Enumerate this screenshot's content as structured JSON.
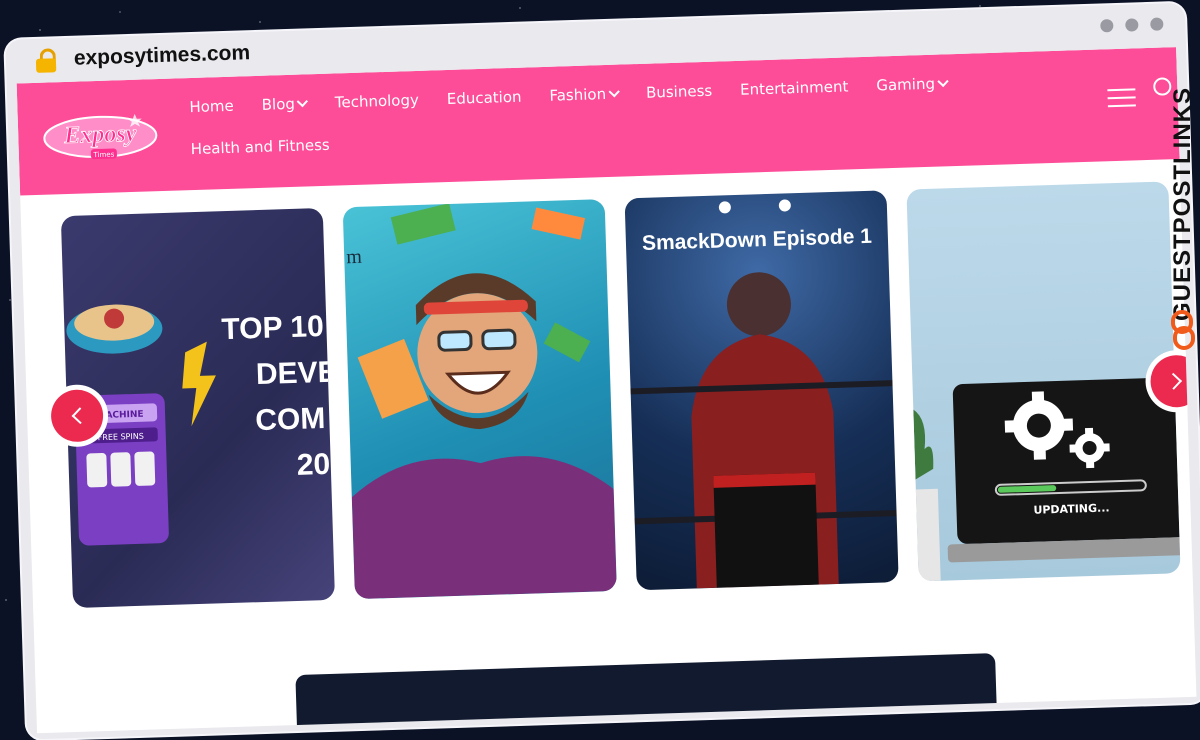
{
  "browser": {
    "url": "exposytimes.com"
  },
  "header": {
    "logo_text": "Exposy",
    "logo_subtext": "Times",
    "nav": [
      {
        "label": "Home",
        "dropdown": false
      },
      {
        "label": "Blog",
        "dropdown": true
      },
      {
        "label": "Technology",
        "dropdown": false
      },
      {
        "label": "Education",
        "dropdown": false
      },
      {
        "label": "Fashion",
        "dropdown": true
      },
      {
        "label": "Business",
        "dropdown": false
      },
      {
        "label": "Entertainment",
        "dropdown": false
      },
      {
        "label": "Gaming",
        "dropdown": true
      },
      {
        "label": "Health and Fitness",
        "dropdown": false
      }
    ]
  },
  "slides": {
    "card1": {
      "lines": [
        "TOP 10",
        "DEVE",
        "COM",
        "20"
      ],
      "machine_label": "MACHINE",
      "machine_sub": "FREE SPINS"
    },
    "card2": {
      "partial_text": "m"
    },
    "card3": {
      "title": "SmackDown Episode 1"
    },
    "card4": {
      "progress_label": "UPDATING...",
      "progress": 0.4
    }
  },
  "watermark": {
    "text": "GUESTPOSTLINKS"
  },
  "colors": {
    "header_pink": "#fd4d98",
    "arrow_red": "#ec2a4f",
    "background": "#0b1226"
  },
  "icons": [
    "lock-icon",
    "window-dot-icon",
    "hamburger-icon",
    "search-icon",
    "chevron-left-icon",
    "chevron-right-icon",
    "chevron-down-icon",
    "chain-link-icon"
  ]
}
